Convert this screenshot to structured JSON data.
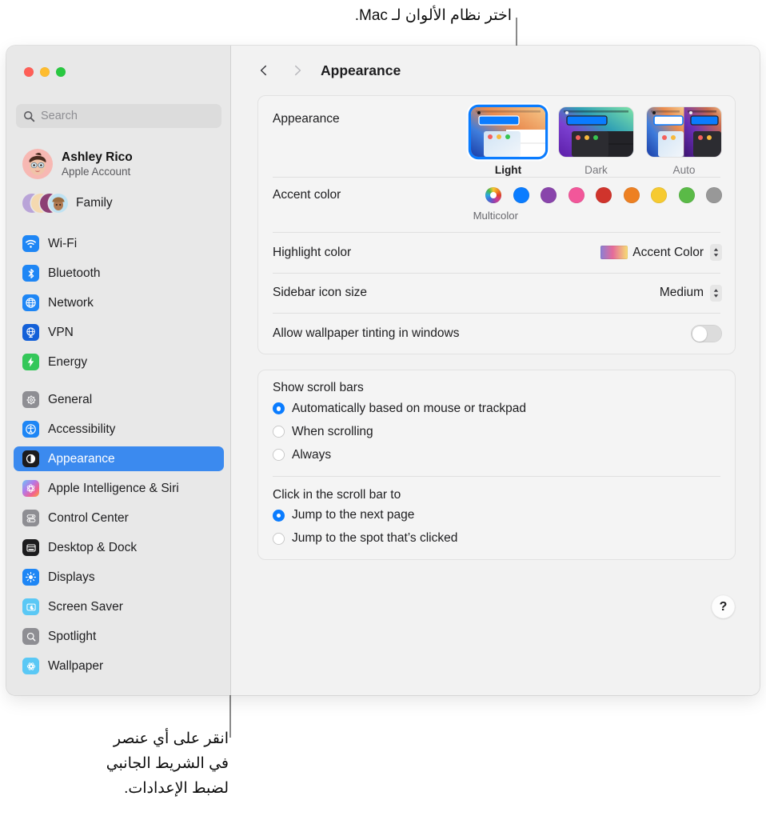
{
  "callouts": {
    "top": "اختر نظام الألوان لـ Mac.",
    "bottom_line1": "انقر على أي عنصر",
    "bottom_line2": "في الشريط الجانبي",
    "bottom_line3": "لضبط الإعدادات."
  },
  "window": {
    "title": "Appearance"
  },
  "sidebar": {
    "search": {
      "placeholder": "Search",
      "value": ""
    },
    "account": {
      "name": "Ashley Rico",
      "subtitle": "Apple Account"
    },
    "family": {
      "label": "Family"
    },
    "items": [
      {
        "label": "Wi-Fi",
        "icon": "wifi-icon",
        "color": "#1e86f5"
      },
      {
        "label": "Bluetooth",
        "icon": "bluetooth-icon",
        "color": "#1e86f5"
      },
      {
        "label": "Network",
        "icon": "globe-icon",
        "color": "#1e86f5"
      },
      {
        "label": "VPN",
        "icon": "vpn-globe-icon",
        "color": "#1360d8"
      },
      {
        "label": "Energy",
        "icon": "bolt-icon",
        "color": "#34c759"
      },
      {
        "label": "General",
        "icon": "gear-icon",
        "color": "#8e8e93"
      },
      {
        "label": "Accessibility",
        "icon": "accessibility-icon",
        "color": "#1e86f5"
      },
      {
        "label": "Appearance",
        "icon": "appearance-icon",
        "color": "#1c1c1e"
      },
      {
        "label": "Apple Intelligence & Siri",
        "icon": "siri-icon",
        "color": "#f06292"
      },
      {
        "label": "Control Center",
        "icon": "control-center-icon",
        "color": "#8e8e93"
      },
      {
        "label": "Desktop & Dock",
        "icon": "desktop-dock-icon",
        "color": "#1c1c1e"
      },
      {
        "label": "Displays",
        "icon": "brightness-icon",
        "color": "#1e86f5"
      },
      {
        "label": "Screen Saver",
        "icon": "screen-saver-icon",
        "color": "#5ac8f5"
      },
      {
        "label": "Spotlight",
        "icon": "spotlight-icon",
        "color": "#8e8e93"
      },
      {
        "label": "Wallpaper",
        "icon": "wallpaper-icon",
        "color": "#5ac8f5"
      }
    ],
    "selected_index": 7
  },
  "main": {
    "appearance": {
      "label": "Appearance",
      "options": [
        {
          "label": "Light",
          "selected": true
        },
        {
          "label": "Dark",
          "selected": false
        },
        {
          "label": "Auto",
          "selected": false
        }
      ]
    },
    "accent_color": {
      "label": "Accent color",
      "caption": "Multicolor",
      "swatches": [
        {
          "name": "multicolor",
          "color": "multicolor",
          "selected": true
        },
        {
          "name": "blue",
          "color": "#0a7cff",
          "selected": false
        },
        {
          "name": "purple",
          "color": "#8944ab",
          "selected": false
        },
        {
          "name": "pink",
          "color": "#f2579a",
          "selected": false
        },
        {
          "name": "red",
          "color": "#d0342c",
          "selected": false
        },
        {
          "name": "orange",
          "color": "#ed8022",
          "selected": false
        },
        {
          "name": "yellow",
          "color": "#f6ca30",
          "selected": false
        },
        {
          "name": "green",
          "color": "#5aba47",
          "selected": false
        },
        {
          "name": "graphite",
          "color": "#989898",
          "selected": false
        }
      ]
    },
    "highlight_color": {
      "label": "Highlight color",
      "value": "Accent Color"
    },
    "sidebar_icon_size": {
      "label": "Sidebar icon size",
      "value": "Medium"
    },
    "wallpaper_tinting": {
      "label": "Allow wallpaper tinting in windows",
      "enabled": false
    },
    "show_scroll_bars": {
      "label": "Show scroll bars",
      "options": [
        {
          "label": "Automatically based on mouse or trackpad",
          "selected": true
        },
        {
          "label": "When scrolling",
          "selected": false
        },
        {
          "label": "Always",
          "selected": false
        }
      ]
    },
    "click_scroll_bar": {
      "label": "Click in the scroll bar to",
      "options": [
        {
          "label": "Jump to the next page",
          "selected": true
        },
        {
          "label": "Jump to the spot that’s clicked",
          "selected": false
        }
      ]
    },
    "help_label": "?"
  }
}
